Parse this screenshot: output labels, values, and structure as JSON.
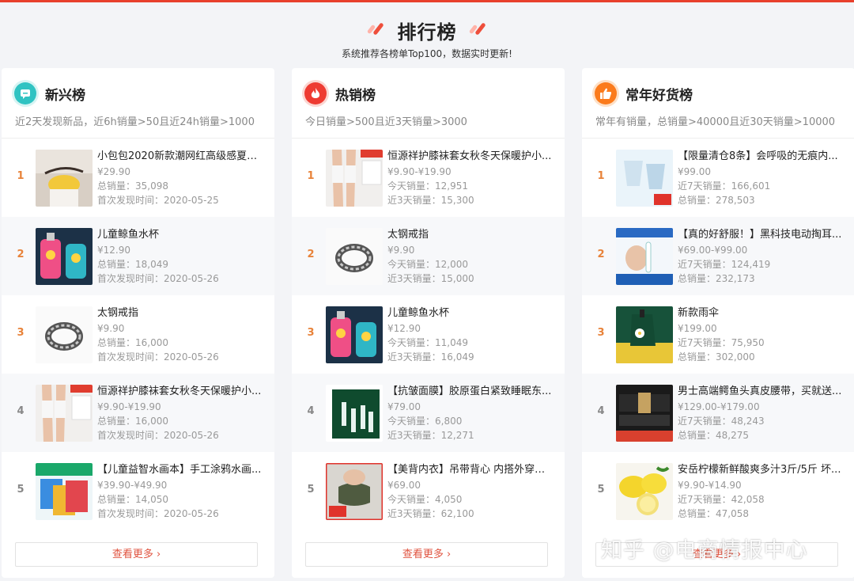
{
  "header": {
    "title": "排行榜",
    "subtitle": "系统推荐各榜单Top100，数据实时更新!"
  },
  "colors": {
    "accent": "#e0533f",
    "rank": "#e8833a"
  },
  "boards": [
    {
      "title": "新兴榜",
      "icon": "chat-icon",
      "description": "近2天发现新品，近6h销量>50且近24h销量>1000",
      "more_label": "查看更多 ›",
      "items": [
        {
          "rank": "1",
          "name": "小包包2020新款潮网红高级感夏天...",
          "price": "¥29.90",
          "line1": "总销量：35,098",
          "line2": "首次发现时间：2020-05-25"
        },
        {
          "rank": "2",
          "name": "儿童鲸鱼水杯",
          "price": "¥12.90",
          "line1": "总销量：18,049",
          "line2": "首次发现时间：2020-05-26"
        },
        {
          "rank": "3",
          "name": "太钢戒指",
          "price": "¥9.90",
          "line1": "总销量：16,000",
          "line2": "首次发现时间：2020-05-26"
        },
        {
          "rank": "4",
          "name": "恒源祥护膝袜套女秋冬天保暖护小...",
          "price": "¥9.90-¥19.90",
          "line1": "总销量：16,000",
          "line2": "首次发现时间：2020-05-26"
        },
        {
          "rank": "5",
          "name": "【儿童益智水画本】手工涂鸦水画...",
          "price": "¥39.90-¥49.90",
          "line1": "总销量：14,050",
          "line2": "首次发现时间：2020-05-26"
        }
      ]
    },
    {
      "title": "热销榜",
      "icon": "flame-icon",
      "description": "今日销量>500且近3天销量>3000",
      "more_label": "查看更多 ›",
      "items": [
        {
          "rank": "1",
          "name": "恒源祥护膝袜套女秋冬天保暖护小...",
          "price": "¥9.90-¥19.90",
          "line1": "今天销量：12,951",
          "line2": "近3天销量：15,300"
        },
        {
          "rank": "2",
          "name": "太钢戒指",
          "price": "¥9.90",
          "line1": "今天销量：12,000",
          "line2": "近3天销量：15,000"
        },
        {
          "rank": "3",
          "name": "儿童鲸鱼水杯",
          "price": "¥12.90",
          "line1": "今天销量：11,049",
          "line2": "近3天销量：16,049"
        },
        {
          "rank": "4",
          "name": "【抗皱面膜】胶原蛋白紧致睡眠东...",
          "price": "¥79.00",
          "line1": "今天销量：6,800",
          "line2": "近3天销量：12,271"
        },
        {
          "rank": "5",
          "name": "【美背内衣】吊带背心 内搭外穿都...",
          "price": "¥69.00",
          "line1": "今天销量：4,050",
          "line2": "近3天销量：62,100"
        }
      ]
    },
    {
      "title": "常年好货榜",
      "icon": "thumbs-up-icon",
      "description": "常年有销量，总销量>40000且近30天销量>10000",
      "more_label": "查看更多 ›",
      "items": [
        {
          "rank": "1",
          "name": "【限量清仓8条】会呼吸的无痕内...",
          "price": "¥99.00",
          "line1": "近7天销量：166,601",
          "line2": "总销量：278,503"
        },
        {
          "rank": "2",
          "name": "【真的好舒服！】黑科技电动掏耳...",
          "price": "¥69.00-¥99.00",
          "line1": "近7天销量：124,419",
          "line2": "总销量：232,173"
        },
        {
          "rank": "3",
          "name": "新款雨伞",
          "price": "¥199.00",
          "line1": "近7天销量：75,950",
          "line2": "总销量：302,000"
        },
        {
          "rank": "4",
          "name": "男士高端鳄鱼头真皮腰带，买就送...",
          "price": "¥129.00-¥179.00",
          "line1": "近7天销量：48,243",
          "line2": "总销量：48,275"
        },
        {
          "rank": "5",
          "name": "安岳柠檬新鲜酸爽多汁3斤/5斤 坏...",
          "price": "¥9.90-¥14.90",
          "line1": "近7天销量：42,058",
          "line2": "总销量：47,058"
        }
      ]
    }
  ],
  "watermark": "知乎 @电商情报中心"
}
